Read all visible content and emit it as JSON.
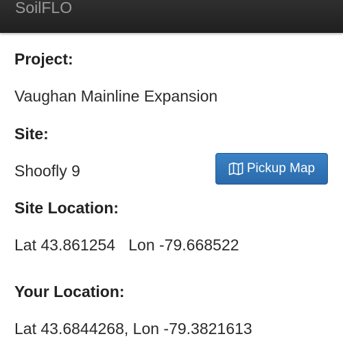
{
  "app": {
    "title": "SoilFLO"
  },
  "project": {
    "label": "Project:",
    "value": "Vaughan Mainline Expansion"
  },
  "site": {
    "label": "Site:",
    "value": "Shoofly 9",
    "pickup_map_label": "Pickup Map"
  },
  "site_location": {
    "label": "Site Location:",
    "value": "Lat 43.861254   Lon -79.668522"
  },
  "your_location": {
    "label": "Your Location:",
    "value": "Lat 43.6844268, Lon -79.3821613"
  },
  "icons": {
    "pickup_map": "map-icon"
  },
  "colors": {
    "app_bar": "#262626",
    "button": "#2f74b6",
    "button_text": "#ffffff"
  }
}
